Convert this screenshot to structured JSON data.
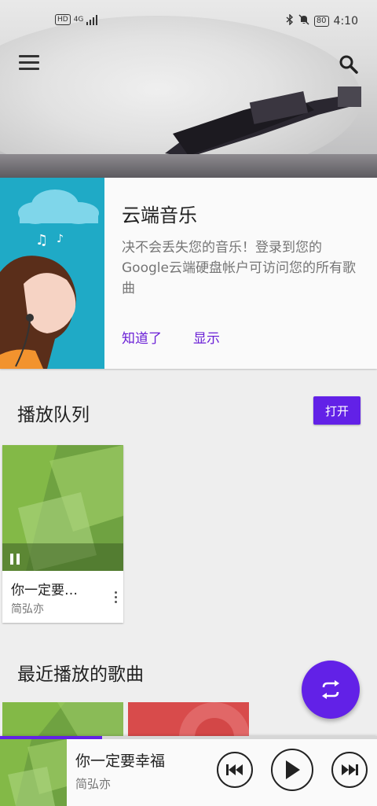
{
  "status_bar": {
    "network_badge": "HD",
    "network_type": "4G",
    "battery": "80",
    "time": "4:10"
  },
  "header": {
    "menu_icon": "menu-icon",
    "search_icon": "search-icon"
  },
  "cloud_card": {
    "title": "云端音乐",
    "description": "决不会丢失您的音乐！登录到您的Google云端硬盘帐户可访问您的所有歌曲",
    "dismiss_label": "知道了",
    "show_label": "显示"
  },
  "queue": {
    "title": "播放队列",
    "open_label": "打开",
    "items": [
      {
        "title": "你一定要…",
        "artist": "简弘亦"
      }
    ]
  },
  "recent": {
    "title": "最近播放的歌曲"
  },
  "player": {
    "title": "你一定要幸福",
    "artist": "简弘亦",
    "progress": 0.27,
    "accent": "#6221e7"
  }
}
